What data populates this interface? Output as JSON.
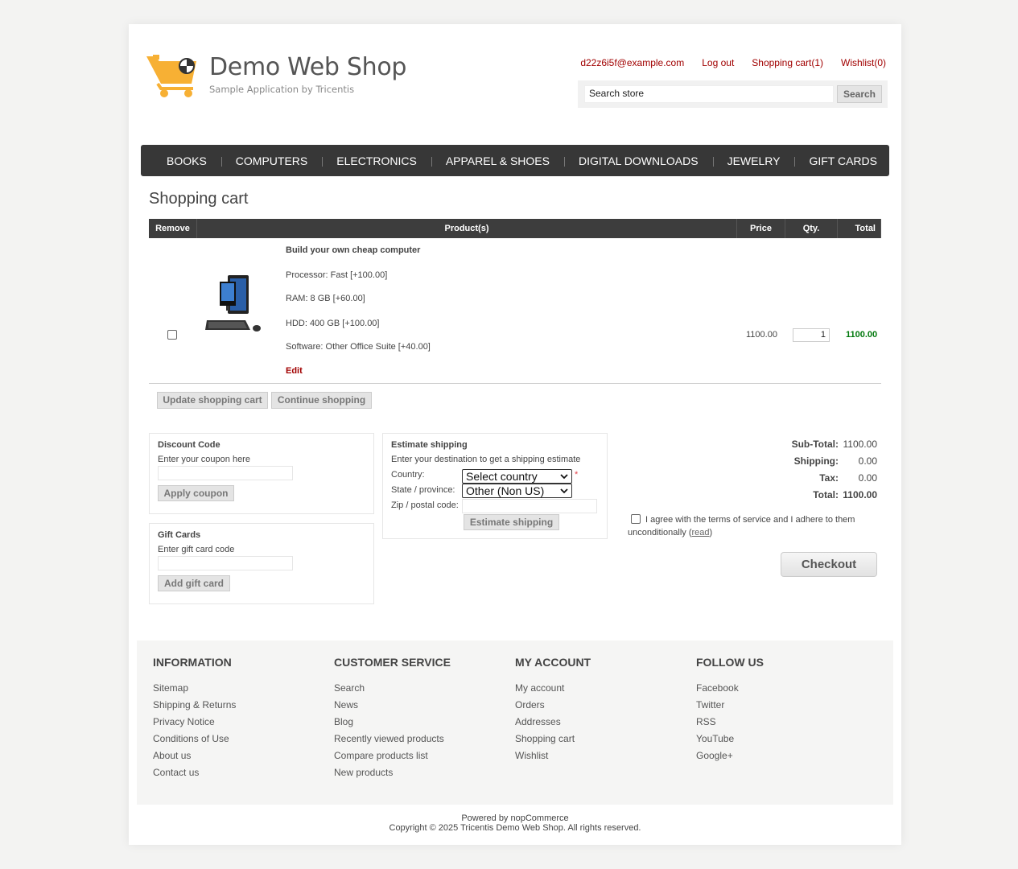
{
  "header": {
    "logo_title": "Demo Web Shop",
    "logo_subtitle": "Sample Application by Tricentis",
    "links": {
      "account": "d22z6i5f@example.com",
      "logout": "Log out",
      "cart": "Shopping cart(1)",
      "wishlist": "Wishlist(0)"
    },
    "search": {
      "value": "Search store",
      "button": "Search"
    }
  },
  "menu": [
    "BOOKS",
    "COMPUTERS",
    "ELECTRONICS",
    "APPAREL & SHOES",
    "DIGITAL DOWNLOADS",
    "JEWELRY",
    "GIFT CARDS"
  ],
  "page_title": "Shopping cart",
  "table": {
    "headers": {
      "remove": "Remove",
      "product": "Product(s)",
      "price": "Price",
      "qty": "Qty.",
      "total": "Total"
    },
    "item": {
      "name": "Build your own cheap computer",
      "attributes": [
        "Processor: Fast [+100.00]",
        "RAM: 8 GB [+60.00]",
        "HDD: 400 GB [+100.00]",
        "Software: Other Office Suite [+40.00]"
      ],
      "edit": "Edit",
      "unit_price": "1100.00",
      "qty": "1",
      "total": "1100.00",
      "remove_checked": false
    }
  },
  "buttons": {
    "update": "Update shopping cart",
    "continue": "Continue shopping"
  },
  "discount": {
    "title": "Discount Code",
    "hint": "Enter your coupon here",
    "button": "Apply coupon"
  },
  "giftcard": {
    "title": "Gift Cards",
    "hint": "Enter gift card code",
    "button": "Add gift card"
  },
  "shipping": {
    "title": "Estimate shipping",
    "hint": "Enter your destination to get a shipping estimate",
    "country_label": "Country:",
    "country_value": "Select country",
    "required_mark": "*",
    "state_label": "State / province:",
    "state_value": "Other (Non US)",
    "zip_label": "Zip / postal code:",
    "button": "Estimate shipping"
  },
  "totals": {
    "subtotal_label": "Sub-Total:",
    "subtotal": "1100.00",
    "shipping_label": "Shipping:",
    "shipping": "0.00",
    "tax_label": "Tax:",
    "tax": "0.00",
    "total_label": "Total:",
    "total": "1100.00"
  },
  "terms": {
    "text": "I agree with the terms of service and I adhere to them unconditionally",
    "link": "read",
    "checked": false
  },
  "checkout": "Checkout",
  "footer": {
    "columns": [
      {
        "title": "INFORMATION",
        "links": [
          "Sitemap",
          "Shipping & Returns",
          "Privacy Notice",
          "Conditions of Use",
          "About us",
          "Contact us"
        ]
      },
      {
        "title": "CUSTOMER SERVICE",
        "links": [
          "Search",
          "News",
          "Blog",
          "Recently viewed products",
          "Compare products list",
          "New products"
        ]
      },
      {
        "title": "MY ACCOUNT",
        "links": [
          "My account",
          "Orders",
          "Addresses",
          "Shopping cart",
          "Wishlist"
        ]
      },
      {
        "title": "FOLLOW US",
        "links": [
          "Facebook",
          "Twitter",
          "RSS",
          "YouTube",
          "Google+"
        ]
      }
    ],
    "powered": "Powered by nopCommerce",
    "copyright": "Copyright © 2025 Tricentis Demo Web Shop. All rights reserved."
  },
  "colors": {
    "link_red": "#a10000",
    "menu_bg": "#373737",
    "total_green": "#00780c",
    "logo_yellow": "#f7b034"
  }
}
